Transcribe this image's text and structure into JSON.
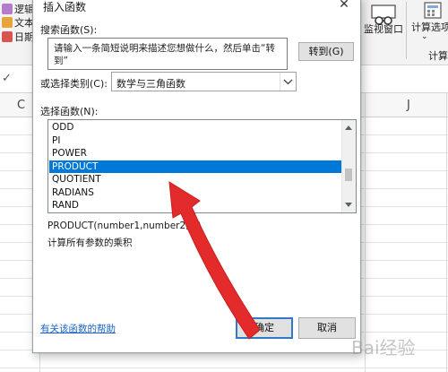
{
  "ribbon": {
    "left_items": [
      "逻辑",
      "文本",
      "日期"
    ],
    "monitor_label": "监视窗口",
    "calc_label": "计算选项",
    "calc_group_label": "计算"
  },
  "grid": {
    "columns": [
      "C",
      "J"
    ]
  },
  "dialog": {
    "title": "插入函数",
    "close_glyph": "✕",
    "search_label": "搜索函数(S):",
    "search_value": "请输入一条简短说明来描述您想做什么，然后单击“转到”",
    "goto_button": "转到(G)",
    "category_label": "或选择类别(C):",
    "category_value": "数学与三角函数",
    "select_label": "选择函数(N):",
    "functions": [
      "ODD",
      "PI",
      "POWER",
      "PRODUCT",
      "QUOTIENT",
      "RADIANS",
      "RAND"
    ],
    "selected_function": "PRODUCT",
    "syntax": "PRODUCT(number1,number2,...)",
    "description": "计算所有参数的乘积",
    "help_link": "有关该函数的帮助",
    "ok_button": "确定",
    "cancel_button": "取消"
  },
  "watermark": "Bai经验",
  "colors": {
    "selection": "#0078d7",
    "link": "#1a62c2",
    "arrow": "#e32b2b",
    "primary_border": "#2f79c9"
  },
  "icons": [
    "logic-icon",
    "text-icon",
    "date-icon",
    "monitor-window-icon",
    "calc-options-icon",
    "cancel-formula-icon",
    "chevron-down-icon",
    "close-icon"
  ]
}
